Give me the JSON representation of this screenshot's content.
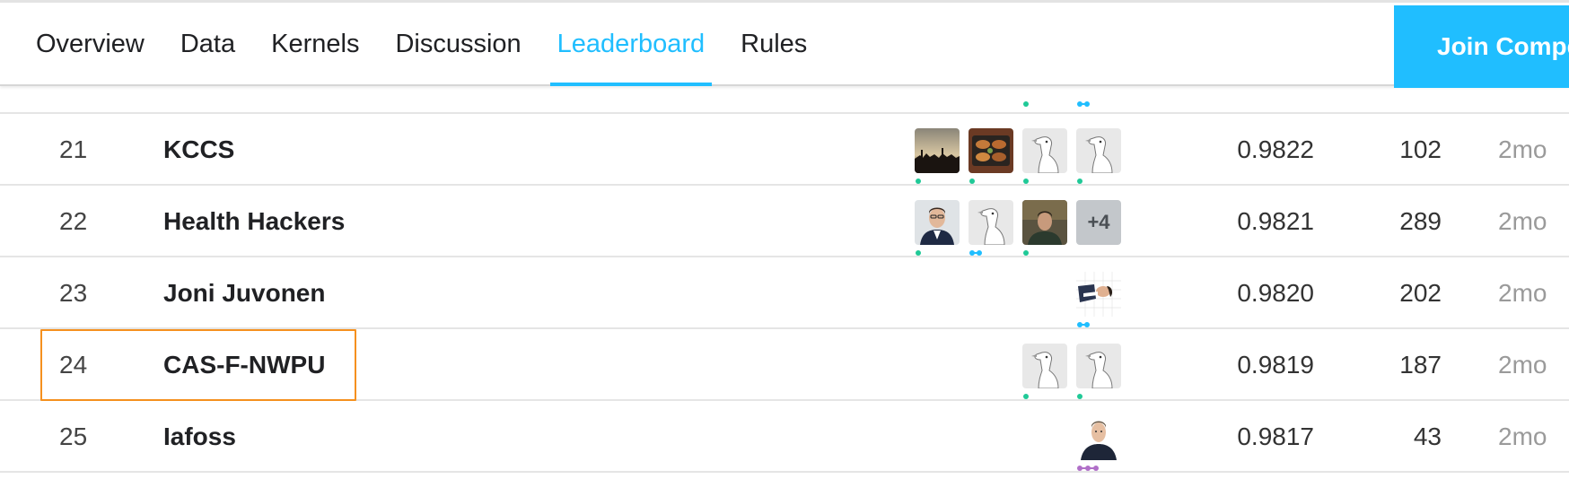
{
  "nav": {
    "tabs": [
      {
        "label": "Overview",
        "active": false
      },
      {
        "label": "Data",
        "active": false
      },
      {
        "label": "Kernels",
        "active": false
      },
      {
        "label": "Discussion",
        "active": false
      },
      {
        "label": "Leaderboard",
        "active": true
      },
      {
        "label": "Rules",
        "active": false
      }
    ],
    "join_label": "Join Compe"
  },
  "rows": [
    {
      "rank": "21",
      "team": "KCCS",
      "score": "0.9822",
      "entries": "102",
      "last": "2mo",
      "members": [
        "landscape-photo-avatar",
        "food-photo-avatar",
        "default-goose-avatar",
        "default-goose-avatar"
      ],
      "member_tiers": [
        "contributor",
        "contributor",
        "contributor",
        "contributor"
      ]
    },
    {
      "rank": "22",
      "team": "Health Hackers",
      "score": "0.9821",
      "entries": "289",
      "last": "2mo",
      "members": [
        "person-photo-avatar",
        "default-goose-avatar",
        "person-photo-avatar"
      ],
      "member_tiers": [
        "contributor",
        "expert",
        "contributor"
      ],
      "extra_members": "+4"
    },
    {
      "rank": "23",
      "team": "Joni Juvonen",
      "score": "0.9820",
      "entries": "202",
      "last": "2mo",
      "members": [
        "person-photo-avatar"
      ],
      "member_tiers": [
        "expert"
      ]
    },
    {
      "rank": "24",
      "team": "CAS-F-NWPU",
      "score": "0.9819",
      "entries": "187",
      "last": "2mo",
      "members": [
        "default-goose-avatar",
        "default-goose-avatar"
      ],
      "member_tiers": [
        "contributor",
        "contributor"
      ]
    },
    {
      "rank": "25",
      "team": "Iafoss",
      "score": "0.9817",
      "entries": "43",
      "last": "2mo",
      "members": [
        "person-photo-avatar"
      ],
      "member_tiers": [
        "master"
      ]
    }
  ],
  "colors": {
    "accent": "#20beff",
    "tier_contributor": "#20c997",
    "tier_expert": "#20beff",
    "tier_master": "#b06fc8",
    "highlight": "#f5901e"
  }
}
